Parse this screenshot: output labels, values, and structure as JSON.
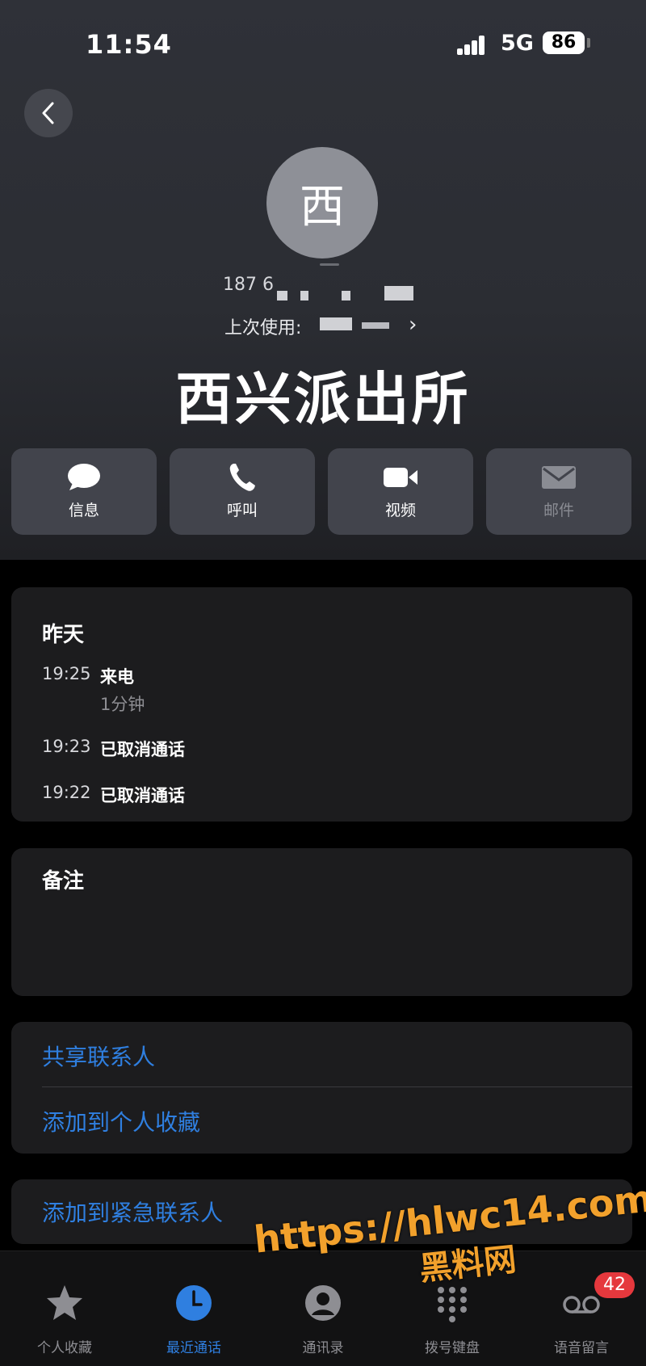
{
  "status_bar": {
    "time": "11:54",
    "network": "5G",
    "battery": "86"
  },
  "contact": {
    "avatar_initial": "西",
    "phone_partial": "187 6",
    "last_used_label": "上次使用:",
    "name": "西兴派出所"
  },
  "actions": [
    {
      "label": "信息",
      "icon": "message-bubble-icon"
    },
    {
      "label": "呼叫",
      "icon": "phone-icon"
    },
    {
      "label": "视频",
      "icon": "video-camera-icon"
    },
    {
      "label": "邮件",
      "icon": "mail-icon",
      "disabled": true
    }
  ],
  "recents": {
    "day": "昨天",
    "calls": [
      {
        "time": "19:25",
        "type": "来电",
        "duration": "1分钟"
      },
      {
        "time": "19:23",
        "type": "已取消通话"
      },
      {
        "time": "19:22",
        "type": "已取消通话"
      }
    ]
  },
  "notes": {
    "title": "备注"
  },
  "options": {
    "share_contact": "共享联系人",
    "add_favorites": "添加到个人收藏",
    "add_emergency": "添加到紧急联系人"
  },
  "tab_bar": {
    "tabs": [
      {
        "label": "个人收藏",
        "icon": "star-icon"
      },
      {
        "label": "最近通话",
        "icon": "clock-icon",
        "active": true
      },
      {
        "label": "通讯录",
        "icon": "person-circle-icon"
      },
      {
        "label": "拨号键盘",
        "icon": "keypad-icon"
      },
      {
        "label": "语音留言",
        "icon": "voicemail-icon",
        "badge": "42"
      }
    ]
  },
  "watermark": {
    "url": "https://hlwc14.com",
    "site_name": "黑料网"
  },
  "colors": {
    "accent": "#2f7fe0",
    "badge": "#e5383d",
    "watermark": "#f2a12c"
  }
}
